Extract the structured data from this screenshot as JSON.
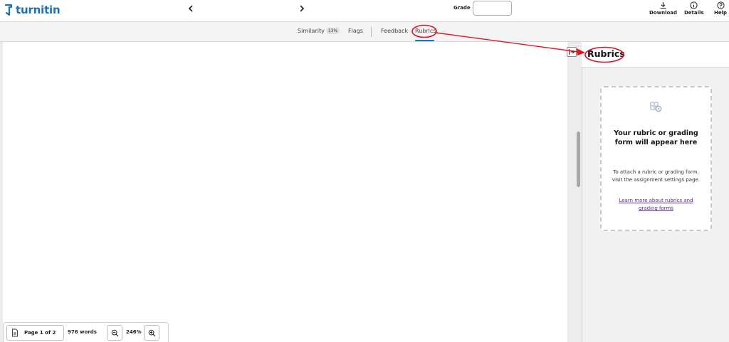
{
  "app": {
    "logo_text": "turnitin"
  },
  "header": {
    "grade_label": "Grade",
    "grade_value": "",
    "tools": [
      {
        "label": "Download",
        "icon": "download-icon"
      },
      {
        "label": "Details",
        "icon": "info-icon"
      },
      {
        "label": "Help",
        "icon": "help-icon"
      }
    ]
  },
  "tabs": {
    "similarity": {
      "label": "Similarity",
      "badge": "13%"
    },
    "flags": {
      "label": "Flags"
    },
    "feedback": {
      "label": "Feedback"
    },
    "rubrics": {
      "label": "Rubrics",
      "active": true
    }
  },
  "doc_toolbar": {
    "page_label": "Page 1 of 2",
    "word_count": "976 words",
    "zoom_level": "246%"
  },
  "side_panel": {
    "title": "Rubrics",
    "empty_title": "Your rubric or grading form will appear here",
    "empty_desc": "To attach a rubric or grading form, visit the assignment settings page.",
    "empty_link": "Learn more about rubrics and grading forms"
  },
  "colors": {
    "brand": "#1b6fb5",
    "active_tab": "#1a73c8",
    "link": "#5b2c8e",
    "annotation": "#e0141e"
  }
}
